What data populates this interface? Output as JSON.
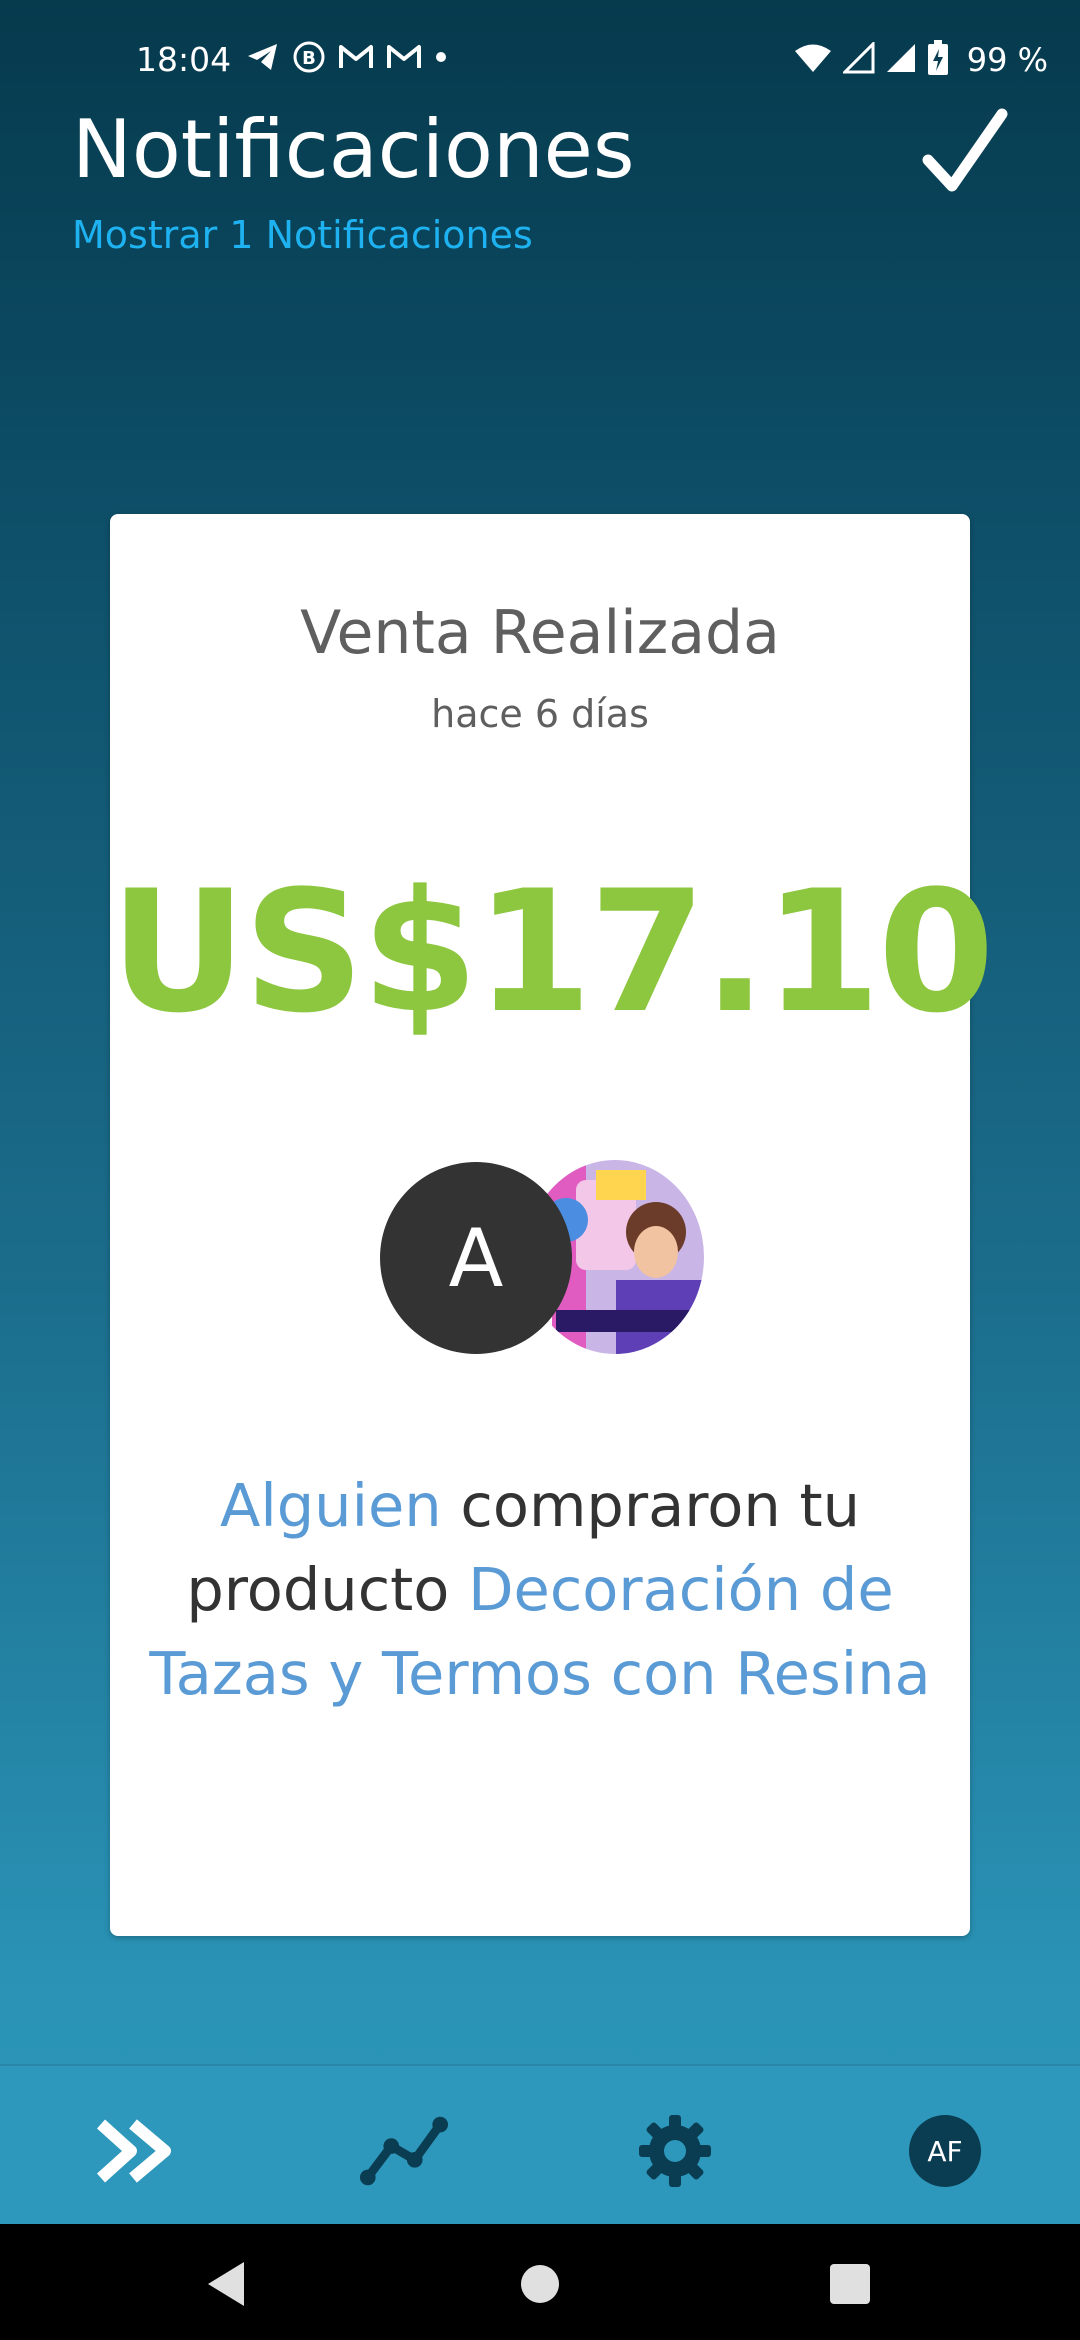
{
  "status_bar": {
    "time": "18:04",
    "battery": "99 %",
    "icons_left": [
      "telegram-icon",
      "b-icon",
      "gmail-icon",
      "gmail-icon",
      "dot-icon"
    ],
    "icons_right": [
      "wifi-icon",
      "signal-icon",
      "signal-icon",
      "battery-icon"
    ]
  },
  "header": {
    "title": "Notificaciones",
    "subtitle": "Mostrar 1 Notificaciones",
    "action_icon": "checkmark-icon"
  },
  "notification": {
    "title": "Venta Realizada",
    "time_ago": "hace 6 días",
    "amount": "US$17.10",
    "buyer_initial": "A",
    "product_image_icon": "product-thumbnail",
    "message_parts": {
      "buyer": "Alguien",
      "text": " compraron tu producto ",
      "product": "Decoración de Tazas y Termos con Resina"
    }
  },
  "bottom_nav": {
    "items": [
      {
        "icon": "forward-arrows-icon"
      },
      {
        "icon": "stats-line-icon"
      },
      {
        "icon": "gear-icon"
      },
      {
        "label": "AF"
      }
    ]
  },
  "colors": {
    "accent_green": "#8dc63f",
    "link_blue": "#5b9bd5",
    "subtitle_blue": "#1fb2f0",
    "nav_bg": "#2d98bb"
  }
}
